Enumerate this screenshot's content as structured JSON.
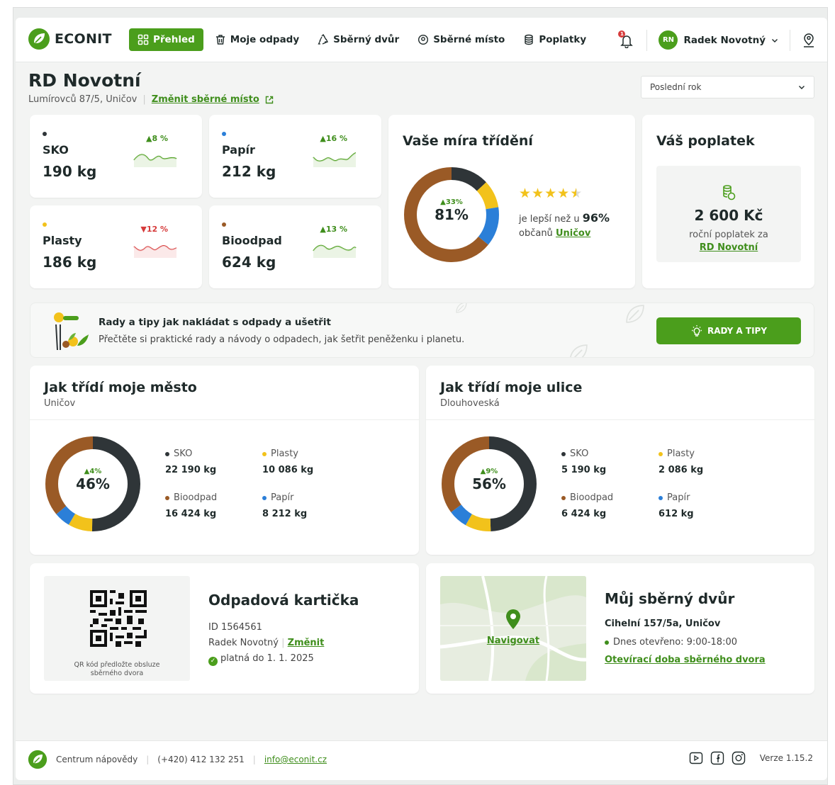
{
  "brand": {
    "name": "ECONIT",
    "accent": "#4b9e1c"
  },
  "nav": [
    {
      "label": "Přehled",
      "icon": "grid-icon",
      "active": true
    },
    {
      "label": "Moje odpady",
      "icon": "trash-icon"
    },
    {
      "label": "Sběrný dvůr",
      "icon": "recycle-icon"
    },
    {
      "label": "Sběrné místo",
      "icon": "location-pin-icon"
    },
    {
      "label": "Poplatky",
      "icon": "coins-icon"
    }
  ],
  "notifications": {
    "count": "1"
  },
  "user": {
    "initials": "RN",
    "name": "Radek Novotný"
  },
  "page": {
    "title": "RD Novotní",
    "address": "Lumírovců 87/5, Uničov",
    "change_place": "Změnit sběrné místo",
    "period": "Poslední rok"
  },
  "waste": [
    {
      "name": "SKO",
      "value": "190 kg",
      "trend": "▲8 %",
      "direction": "up",
      "color": "#2f3538"
    },
    {
      "name": "Papír",
      "value": "212 kg",
      "trend": "▲16 %",
      "direction": "up",
      "color": "#2b7fd8"
    },
    {
      "name": "Plasty",
      "value": "186 kg",
      "trend": "▼12 %",
      "direction": "down",
      "color": "#f2c21b"
    },
    {
      "name": "Bioodpad",
      "value": "624 kg",
      "trend": "▲13 %",
      "direction": "up",
      "color": "#9a5a26"
    }
  ],
  "sorting_rate": {
    "title": "Vaše míra třídění",
    "trend": "▲33%",
    "percent": "81%",
    "stars": 4.5,
    "text_before": "je lepší než u",
    "better_than": "96%",
    "text_after": "občanů",
    "town": "Uničov"
  },
  "fee": {
    "title": "Váš poplatek",
    "amount": "2 600 Kč",
    "label": "roční poplatek za",
    "place": "RD Novotní"
  },
  "tips": {
    "title": "Rady a tipy jak nakládat s odpady a ušetřit",
    "subtitle": "Přečtěte si praktické rady a návody o odpadech, jak šetřit peněženku i planetu.",
    "button": "RADY A TIPY"
  },
  "city": {
    "title": "Jak třídí moje město",
    "name": "Uničov",
    "trend": "▲4%",
    "percent": "46%",
    "legend": [
      {
        "name": "SKO",
        "value": "22 190 kg",
        "color": "#2f3538"
      },
      {
        "name": "Plasty",
        "value": "10 086 kg",
        "color": "#f2c21b"
      },
      {
        "name": "Bioodpad",
        "value": "16 424 kg",
        "color": "#9a5a26"
      },
      {
        "name": "Papír",
        "value": "8 212 kg",
        "color": "#2b7fd8"
      }
    ]
  },
  "street": {
    "title": "Jak třídí moje ulice",
    "name": "Dlouhoveská",
    "trend": "▲9%",
    "percent": "56%",
    "legend": [
      {
        "name": "SKO",
        "value": "5 190 kg",
        "color": "#2f3538"
      },
      {
        "name": "Plasty",
        "value": "2 086 kg",
        "color": "#f2c21b"
      },
      {
        "name": "Bioodpad",
        "value": "6 424 kg",
        "color": "#9a5a26"
      },
      {
        "name": "Papír",
        "value": "612 kg",
        "color": "#2b7fd8"
      }
    ]
  },
  "card": {
    "title": "Odpadová kartička",
    "qr_caption": "QR kód předložte obsluze sběrného dvora",
    "id": "ID 1564561",
    "holder": "Radek Novotný",
    "change": "Změnit",
    "valid": "platná do 1. 1. 2025"
  },
  "yard": {
    "title": "Můj sběrný dvůr",
    "address": "Cihelní 157/5a, Uničov",
    "open": "Dnes otevřeno: 9:00-18:00",
    "hours_link": "Otevírací doba sběrného dvora",
    "navigate": "Navigovat"
  },
  "footer": {
    "help": "Centrum nápovědy",
    "phone": "(+420) 412 132 251",
    "email": "info@econit.cz",
    "version": "Verze 1.15.2"
  }
}
